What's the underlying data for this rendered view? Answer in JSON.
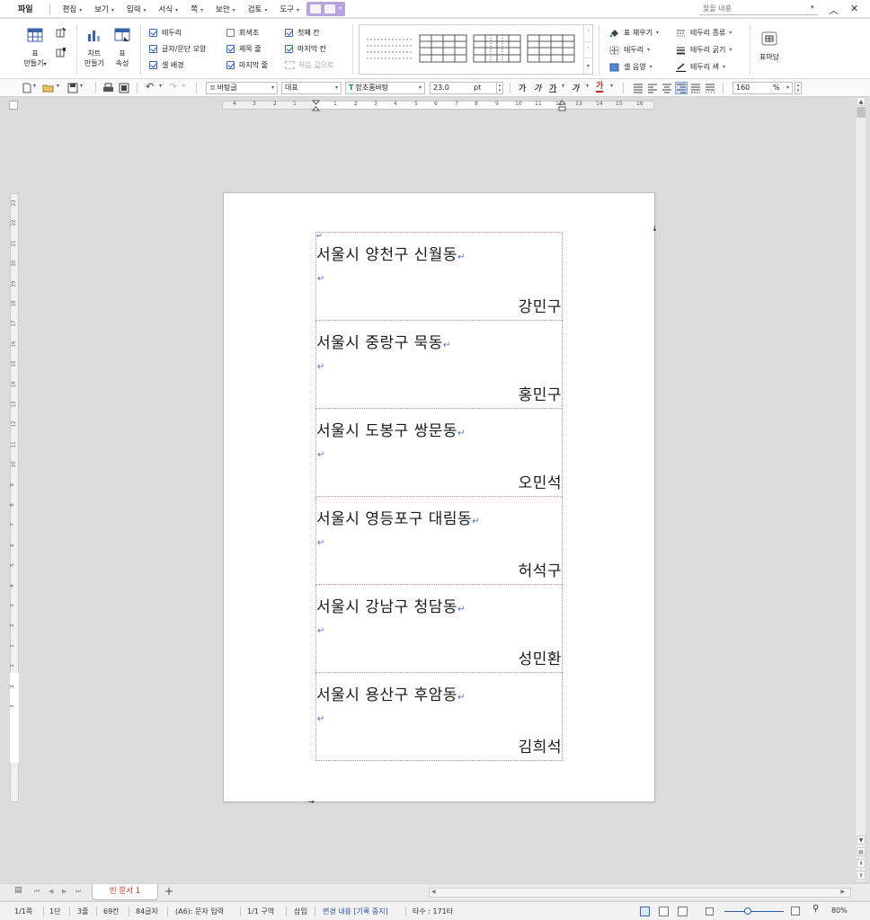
{
  "menu": {
    "file": "파일",
    "items": [
      "편집",
      "보기",
      "입력",
      "서식",
      "쪽",
      "보안",
      "검토",
      "도구"
    ],
    "search_placeholder": "찾을 내용"
  },
  "ribbon": {
    "table_make": [
      "표",
      "만들기"
    ],
    "chart_make": [
      "차트",
      "만들기"
    ],
    "table_props": [
      "표",
      "속성"
    ],
    "checks_col1": [
      {
        "label": "테두리",
        "checked": true
      },
      {
        "label": "글자/문단 모양",
        "checked": true
      },
      {
        "label": "셀 배경",
        "checked": true
      }
    ],
    "checks_col2": [
      {
        "label": "회색조",
        "checked": false
      },
      {
        "label": "제목 줄",
        "checked": true
      },
      {
        "label": "마지막 줄",
        "checked": true
      }
    ],
    "checks_col3": [
      {
        "label": "첫째 칸",
        "checked": true
      },
      {
        "label": "마지막 칸",
        "checked": true
      }
    ],
    "reset_label": "처음 값으로",
    "fill_items": [
      "표 채우기",
      "테두리",
      "셀 음영"
    ],
    "border_items": [
      "테두리 종류",
      "테두리 굵기",
      "테두리 색"
    ],
    "table_madang": "표마당"
  },
  "toolbar": {
    "style": "바탕글",
    "lang": "대표",
    "font": "함초롬바탕",
    "size": "23.0",
    "unit": "pt",
    "bold": "가",
    "italic": "가",
    "underline": "가",
    "strike": "가",
    "color_text": "가",
    "linespacing": "160",
    "linespacing_unit": "%"
  },
  "ruler": {
    "h_numbers": [
      "4",
      "3",
      "2",
      "1",
      "1",
      "2",
      "3",
      "4",
      "5",
      "6",
      "7",
      "8",
      "9",
      "10",
      "11",
      "12",
      "13",
      "14",
      "15",
      "16"
    ],
    "v_numbers": [
      "23",
      "22",
      "21",
      "20",
      "19",
      "18",
      "17",
      "16",
      "15",
      "14",
      "13",
      "12",
      "11",
      "10",
      "9",
      "8",
      "7",
      "6",
      "5",
      "4",
      "3",
      "2",
      "1",
      "1",
      "2",
      "3"
    ]
  },
  "labels": [
    {
      "address": "서울시 양천구 신월동",
      "name": "강민구"
    },
    {
      "address": "서울시 중랑구 묵동",
      "name": "홍민구"
    },
    {
      "address": "서울시 도봉구 쌍문동",
      "name": "오민석"
    },
    {
      "address": "서울시 영등포구 대림동",
      "name": "허석구"
    },
    {
      "address": "서울시 강남구 청담동",
      "name": "성민환"
    },
    {
      "address": "서울시 용산구 후암동",
      "name": "김희석"
    }
  ],
  "tabs": {
    "doc_tab": "빈 문서 1",
    "add": "+"
  },
  "status": {
    "page": "1/1쪽",
    "column": "1단",
    "line": "3줄",
    "col": "69칸",
    "chars": "84글자",
    "mode": "(A6): 문자 입력",
    "section": "1/1 구역",
    "insert": "삽입",
    "track": "변경 내용 [기록 중지]",
    "keys": "타수 : 171타",
    "zoom": "80%"
  },
  "colors": {
    "accent": "#b6a5e0",
    "table_border": "#e27a93",
    "para_mark": "#3d6fd0",
    "tab_text": "#c0392b"
  }
}
